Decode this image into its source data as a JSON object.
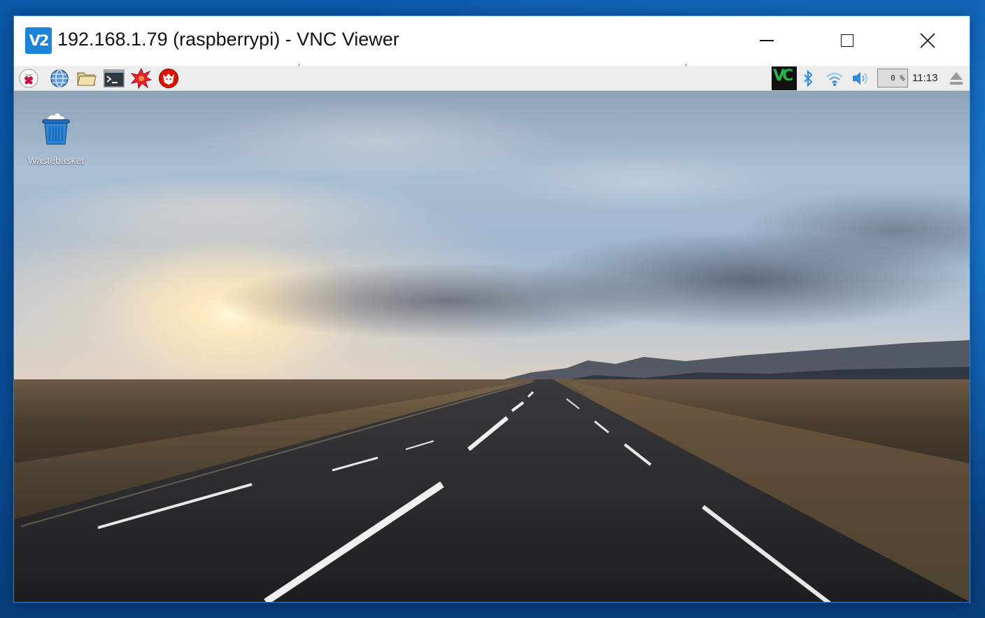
{
  "window": {
    "title": "192.168.1.79 (raspberrypi) - VNC Viewer",
    "app_icon_text": "V2"
  },
  "taskbar": {
    "launchers": [
      {
        "icon": "raspberry-menu-icon"
      },
      {
        "icon": "web-browser-icon"
      },
      {
        "icon": "file-manager-icon"
      },
      {
        "icon": "terminal-icon"
      },
      {
        "icon": "mathematica-icon"
      },
      {
        "icon": "wolfram-icon"
      }
    ],
    "tray": {
      "vnc_icon_text": "VC",
      "cpu_usage": "0 %",
      "clock": "11:13"
    }
  },
  "desktop": {
    "icons": [
      {
        "label": "Wastebasket",
        "icon": "wastebasket-icon"
      }
    ]
  },
  "colors": {
    "vnc_blue": "#1b84d8",
    "taskbar_bg": "#ededed",
    "tray_icon_blue": "#2a8be0"
  }
}
